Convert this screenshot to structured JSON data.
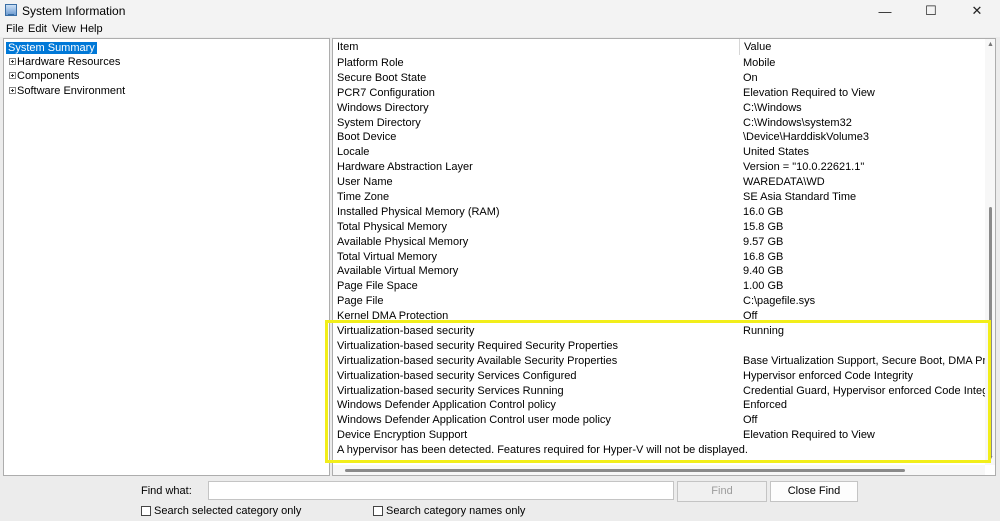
{
  "window": {
    "title": "System Information",
    "minimize_glyph": "—",
    "maximize_glyph": "☐",
    "close_glyph": "✕"
  },
  "menu": [
    "File",
    "Edit",
    "View",
    "Help"
  ],
  "tree": [
    {
      "label": "System Summary",
      "selected": true,
      "expandable": false
    },
    {
      "label": "Hardware Resources",
      "selected": false,
      "expandable": true
    },
    {
      "label": "Components",
      "selected": false,
      "expandable": true
    },
    {
      "label": "Software Environment",
      "selected": false,
      "expandable": true
    }
  ],
  "table": {
    "headers": {
      "item": "Item",
      "value": "Value"
    },
    "rows": [
      {
        "item": "Platform Role",
        "value": "Mobile"
      },
      {
        "item": "Secure Boot State",
        "value": "On"
      },
      {
        "item": "PCR7 Configuration",
        "value": "Elevation Required to View"
      },
      {
        "item": "Windows Directory",
        "value": "C:\\Windows"
      },
      {
        "item": "System Directory",
        "value": "C:\\Windows\\system32"
      },
      {
        "item": "Boot Device",
        "value": "\\Device\\HarddiskVolume3"
      },
      {
        "item": "Locale",
        "value": "United States"
      },
      {
        "item": "Hardware Abstraction Layer",
        "value": "Version = \"10.0.22621.1\""
      },
      {
        "item": "User Name",
        "value": "WAREDATA\\WD"
      },
      {
        "item": "Time Zone",
        "value": "SE Asia Standard Time"
      },
      {
        "item": "Installed Physical Memory (RAM)",
        "value": "16.0 GB"
      },
      {
        "item": "Total Physical Memory",
        "value": "15.8 GB"
      },
      {
        "item": "Available Physical Memory",
        "value": "9.57 GB"
      },
      {
        "item": "Total Virtual Memory",
        "value": "16.8 GB"
      },
      {
        "item": "Available Virtual Memory",
        "value": "9.40 GB"
      },
      {
        "item": "Page File Space",
        "value": "1.00 GB"
      },
      {
        "item": "Page File",
        "value": "C:\\pagefile.sys"
      },
      {
        "item": "Kernel DMA Protection",
        "value": "Off"
      },
      {
        "item": "Virtualization-based security",
        "value": "Running"
      },
      {
        "item": "Virtualization-based security Required Security Properties",
        "value": ""
      },
      {
        "item": "Virtualization-based security Available Security Properties",
        "value": "Base Virtualization Support, Secure Boot, DMA Protection"
      },
      {
        "item": "Virtualization-based security Services Configured",
        "value": "Hypervisor enforced Code Integrity"
      },
      {
        "item": "Virtualization-based security Services Running",
        "value": "Credential Guard, Hypervisor enforced Code Integrity"
      },
      {
        "item": "Windows Defender Application Control policy",
        "value": "Enforced"
      },
      {
        "item": "Windows Defender Application Control user mode policy",
        "value": "Off"
      },
      {
        "item": "Device Encryption Support",
        "value": "Elevation Required to View"
      },
      {
        "item": "A hypervisor has been detected. Features required for Hyper-V will not be displayed.",
        "value": ""
      }
    ]
  },
  "find": {
    "label": "Find what:",
    "value": "",
    "find_button": "Find",
    "close_find_button": "Close Find",
    "search_selected_category": "Search selected category only",
    "search_category_names": "Search category names only"
  },
  "colors": {
    "selection": "#0078d7",
    "highlight_box": "#f2ee1a"
  }
}
